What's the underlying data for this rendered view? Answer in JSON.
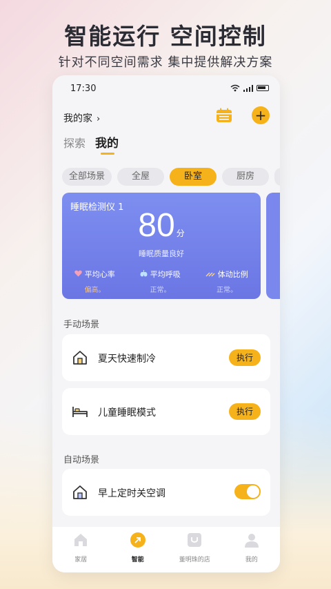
{
  "promo": {
    "headline": "智能运行 空间控制",
    "subline": "针对不同空间需求  集中提供解决方案"
  },
  "status_bar": {
    "time": "17:30"
  },
  "header": {
    "home_title": "我的家",
    "tabs": [
      {
        "label": "探索",
        "active": false
      },
      {
        "label": "我的",
        "active": true
      }
    ]
  },
  "room_chips": [
    {
      "label": "全部场景",
      "active": false
    },
    {
      "label": "全屋",
      "active": false
    },
    {
      "label": "卧室",
      "active": true
    },
    {
      "label": "厨房",
      "active": false
    }
  ],
  "sleep_card": {
    "title": "睡眠检测仪 1",
    "score": "80",
    "unit": "分",
    "quality": "睡眠质量良好",
    "metrics": [
      {
        "icon": "heart-icon",
        "label": "平均心率",
        "value": "偏高。"
      },
      {
        "icon": "lungs-icon",
        "label": "平均呼吸",
        "value": "正常。"
      },
      {
        "icon": "motion-icon",
        "label": "体动比例",
        "value": "正常。"
      }
    ]
  },
  "manual_scenes": {
    "title": "手动场景",
    "items": [
      {
        "label": "夏天快速制冷",
        "action": "执行",
        "icon": "house-icon"
      },
      {
        "label": "儿童睡眠模式",
        "action": "执行",
        "icon": "bed-icon"
      }
    ]
  },
  "auto_scenes": {
    "title": "自动场景",
    "items": [
      {
        "label": "早上定时关空调",
        "enabled": true,
        "icon": "house-icon"
      }
    ]
  },
  "bottom_nav": [
    {
      "label": "家居",
      "icon": "home-icon",
      "active": false
    },
    {
      "label": "智能",
      "icon": "smart-icon",
      "active": true
    },
    {
      "label": "董明珠的店",
      "icon": "shop-icon",
      "active": false
    },
    {
      "label": "我的",
      "icon": "profile-icon",
      "active": false
    }
  ],
  "colors": {
    "accent": "#f6b21b",
    "card": "#7080ea"
  }
}
